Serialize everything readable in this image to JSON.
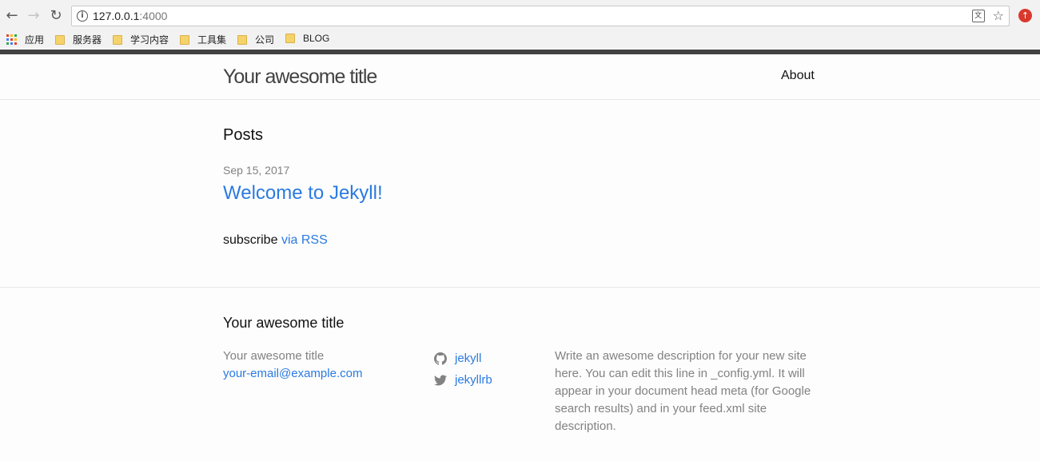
{
  "browser": {
    "url_host": "127.0.0.1",
    "url_port": ":4000",
    "bookmarks": [
      "应用",
      "服务器",
      "学习内容",
      "工具集",
      "公司",
      "BLOG"
    ]
  },
  "site": {
    "title": "Your awesome title",
    "nav": {
      "about": "About"
    }
  },
  "main": {
    "heading": "Posts",
    "posts": [
      {
        "date": "Sep 15, 2017",
        "title": "Welcome to Jekyll!"
      }
    ],
    "subscribe_text": "subscribe",
    "rss_link": "via RSS"
  },
  "footer": {
    "heading": "Your awesome title",
    "name": "Your awesome title",
    "email": "your-email@example.com",
    "github": "jekyll",
    "twitter": "jekyllrb",
    "description": "Write an awesome description for your new site here. You can edit this line in _config.yml. It will appear in your document head meta (for Google search results) and in your feed.xml site description."
  },
  "colors": {
    "link": "#2a7ae2",
    "muted": "#828282",
    "header_bar": "#424242"
  }
}
